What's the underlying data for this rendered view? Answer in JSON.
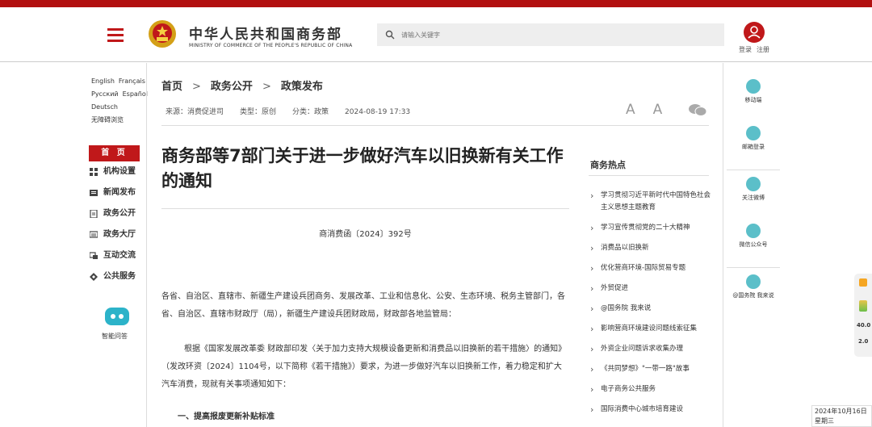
{
  "header": {
    "site_name_cn": "中华人民共和国商务部",
    "site_name_en": "MINISTRY OF COMMERCE OF THE PEOPLE'S REPUBLIC OF CHINA",
    "search_placeholder": "请输入关键字",
    "login": "登录",
    "register": "注册"
  },
  "languages": [
    "English",
    "Français",
    "Русский",
    "Español",
    "Deutsch",
    "无障碍浏览"
  ],
  "left_nav": {
    "home": "首 页",
    "items": [
      "机构设置",
      "新闻发布",
      "政务公开",
      "政务大厅",
      "互动交流",
      "公共服务"
    ],
    "assistant": "智能问答"
  },
  "breadcrumb": [
    "首页",
    "政务公开",
    "政策发布"
  ],
  "meta": {
    "source": "来源：消费促进司",
    "type": "类型：原创",
    "category": "分类：政策",
    "datetime": "2024-08-19 17:33"
  },
  "tools": {
    "font_large": "A",
    "font_small": "A"
  },
  "article": {
    "title": "商务部等7部门关于进一步做好汽车以旧换新有关工作的通知",
    "doc_number": "商消费函〔2024〕392号",
    "para1": "各省、自治区、直辖市、新疆生产建设兵团商务、发展改革、工业和信息化、公安、生态环境、税务主管部门，各省、自治区、直辖市财政厅（局），新疆生产建设兵团财政局，财政部各地监管局：",
    "para2": "根据《国家发展改革委 财政部印发〈关于加力支持大规模设备更新和消费品以旧换新的若干措施〉的通知》（发改环资〔2024〕1104号，以下简称《若干措施》）要求，为进一步做好汽车以旧换新工作，着力稳定和扩大汽车消费，现就有关事项通知如下：",
    "heading1": "一、提高报废更新补贴标准"
  },
  "hot": {
    "title": "商务热点",
    "items": [
      "学习贯彻习近平新时代中国特色社会主义思想主题教育",
      "学习宣传贯彻党的二十大精神",
      "消费品以旧换新",
      "优化营商环境-国际贸易专题",
      "外贸促进",
      "@国务院 我来说",
      "影响营商环境建设问题线索征集",
      "外资企业问题诉求收集办理",
      "《共同梦想》\"一带一路\"故事",
      "电子商务公共服务",
      "国际消费中心城市培育建设"
    ]
  },
  "right_tools": [
    "移动端",
    "邮箱登录",
    "关注微博",
    "微信公众号",
    "@国务院 我来说"
  ],
  "side_widget": {
    "speed1": "40.0",
    "speed2": "2.0"
  },
  "datebox": {
    "date": "2024年10月16日",
    "weekday": "星期三"
  },
  "colors": {
    "brand_red": "#c0181a",
    "top_bar": "#b2100f",
    "teal": "#5bbfc9"
  }
}
